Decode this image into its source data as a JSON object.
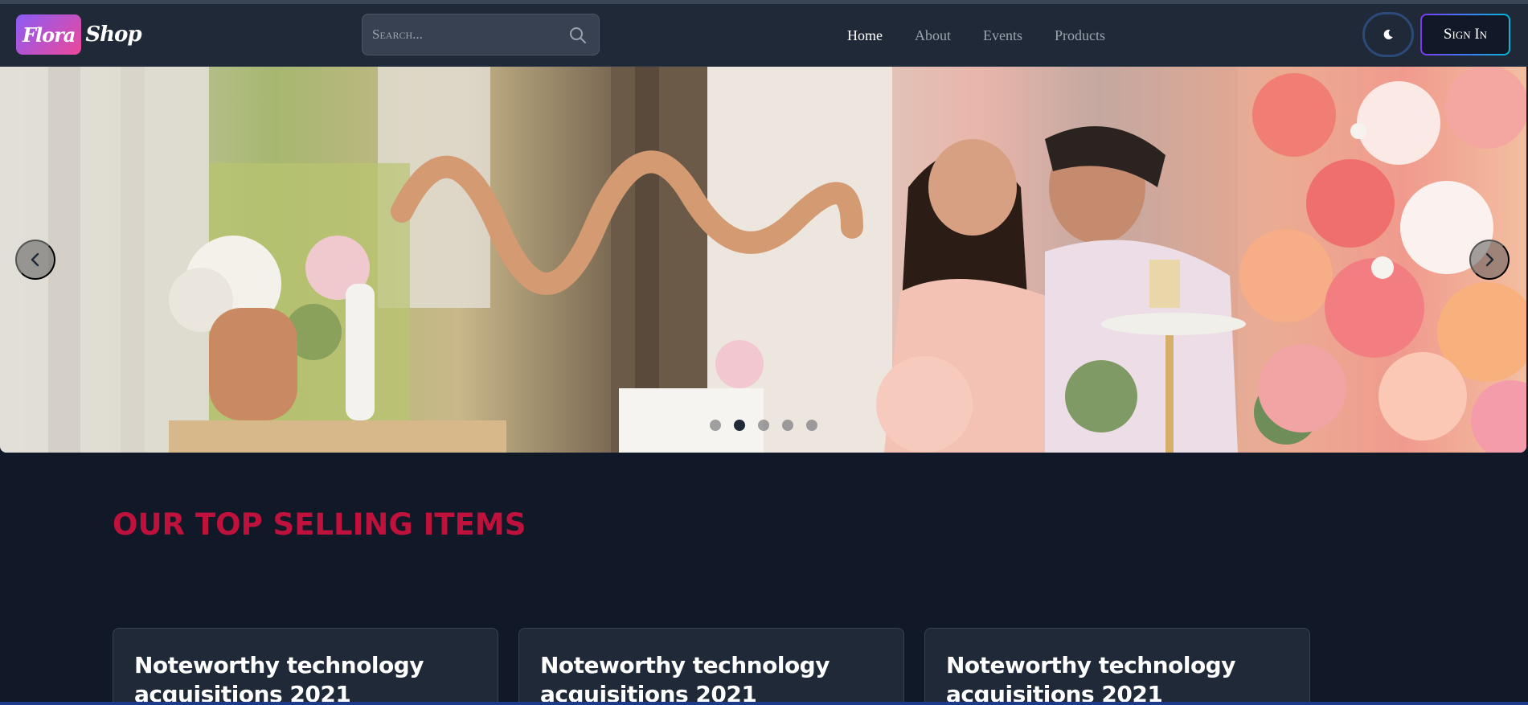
{
  "brand": {
    "logo_part1": "Flora",
    "logo_part2": "Shop"
  },
  "search": {
    "placeholder": "Search..."
  },
  "nav": {
    "items": [
      {
        "label": "Home",
        "active": true
      },
      {
        "label": "About",
        "active": false
      },
      {
        "label": "Events",
        "active": false
      },
      {
        "label": "Products",
        "active": false
      }
    ]
  },
  "header": {
    "theme_toggle_icon": "moon-icon",
    "signin_label": "Sign In"
  },
  "carousel": {
    "slide_count": 5,
    "active_index": 1,
    "prev_icon": "chevron-left-icon",
    "next_icon": "chevron-right-icon"
  },
  "section": {
    "title": "OUR TOP SELLING ITEMS"
  },
  "cards": [
    {
      "title": "Noteworthy technology acquisitions 2021"
    },
    {
      "title": "Noteworthy technology acquisitions 2021"
    },
    {
      "title": "Noteworthy technology acquisitions 2021"
    }
  ],
  "colors": {
    "accent_title": "#be123c",
    "background": "#111827",
    "navbar": "#1f2937"
  }
}
